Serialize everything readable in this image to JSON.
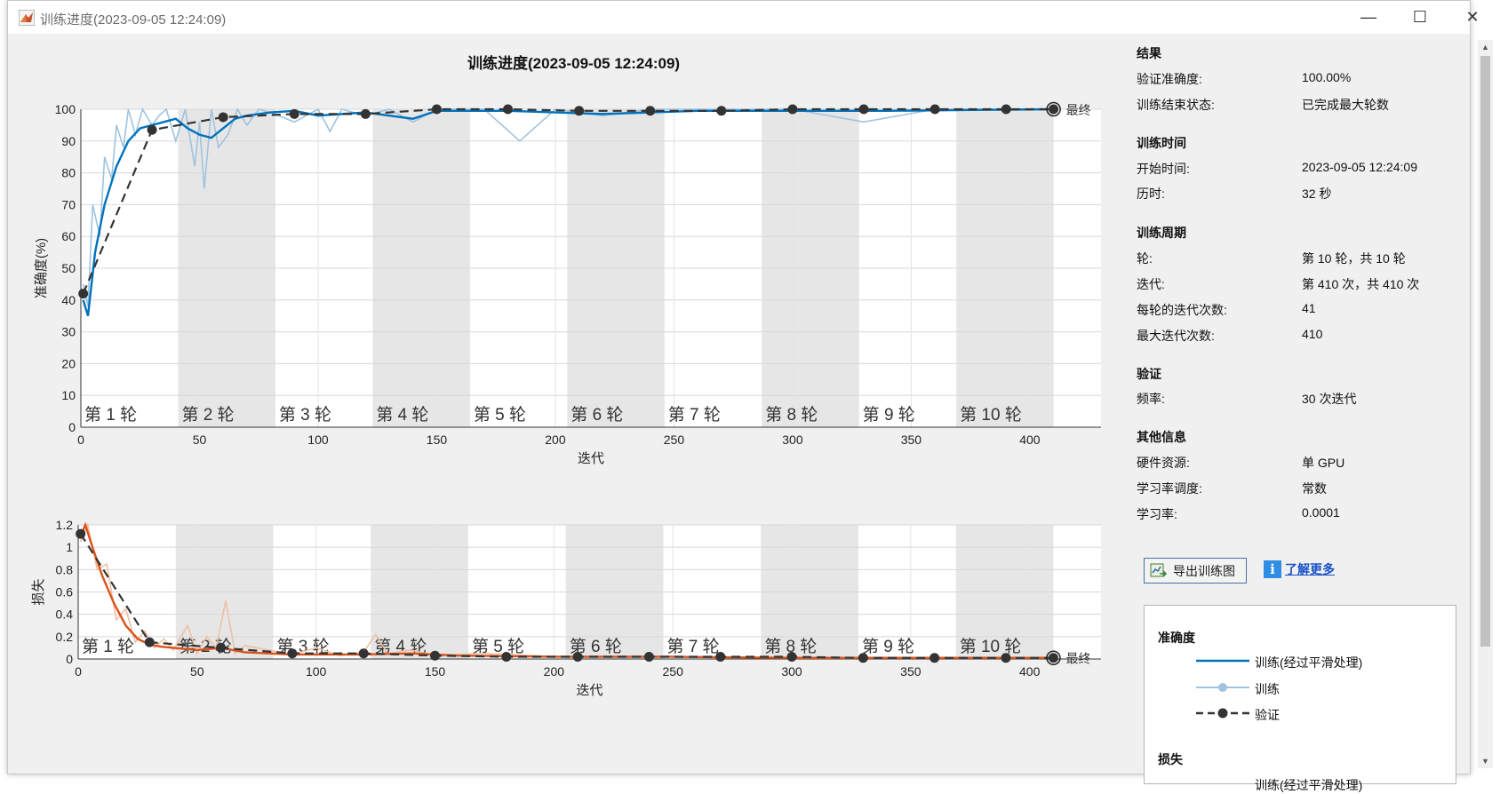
{
  "window": {
    "title": "训练进度(2023-09-05 12:24:09)",
    "minimize": "—",
    "maximize": "☐",
    "close": "✕"
  },
  "plot_title": "训练进度(2023-09-05 12:24:09)",
  "side": {
    "results": {
      "heading": "结果",
      "rows": [
        {
          "k": "验证准确度:",
          "v": "100.00%"
        },
        {
          "k": "训练结束状态:",
          "v": "已完成最大轮数"
        }
      ]
    },
    "time": {
      "heading": "训练时间",
      "rows": [
        {
          "k": "开始时间:",
          "v": "2023-09-05 12:24:09"
        },
        {
          "k": "历时:",
          "v": "32 秒"
        }
      ]
    },
    "cycle": {
      "heading": "训练周期",
      "rows": [
        {
          "k": "轮:",
          "v": "第 10 轮，共 10 轮"
        },
        {
          "k": "迭代:",
          "v": "第 410 次，共 410 次"
        },
        {
          "k": "每轮的迭代次数:",
          "v": "41"
        },
        {
          "k": "最大迭代次数:",
          "v": "410"
        }
      ]
    },
    "validation": {
      "heading": "验证",
      "rows": [
        {
          "k": "频率:",
          "v": "30 次迭代"
        }
      ]
    },
    "other": {
      "heading": "其他信息",
      "rows": [
        {
          "k": "硬件资源:",
          "v": "单 GPU"
        },
        {
          "k": "学习率调度:",
          "v": "常数"
        },
        {
          "k": "学习率:",
          "v": "0.0001"
        }
      ]
    }
  },
  "export_button": "导出训练图",
  "learn_more": "了解更多",
  "legend": {
    "accuracy_heading": "准确度",
    "items": [
      "训练(经过平滑处理)",
      "训练",
      "验证"
    ],
    "loss_heading": "损失",
    "loss_first_item": "训练(经过平滑处理)"
  },
  "colors": {
    "accuracy_smoothed": "#0072bd",
    "accuracy_raw": "#9fc3e0",
    "loss_smoothed": "#d95319",
    "loss_raw": "#efbfa6",
    "validation": "#333333",
    "epoch_band": "#e6e6e6"
  },
  "chart_data": [
    {
      "type": "line",
      "title": "",
      "xlabel": "迭代",
      "ylabel": "准确度(%)",
      "xlim": [
        0,
        430
      ],
      "ylim": [
        0,
        100
      ],
      "xticks": [
        0,
        50,
        100,
        150,
        200,
        250,
        300,
        350,
        400
      ],
      "yticks": [
        0,
        10,
        20,
        30,
        40,
        50,
        60,
        70,
        80,
        90,
        100
      ],
      "grid": true,
      "epoch_labels": [
        "第 1 轮",
        "第 2 轮",
        "第 3 轮",
        "第 4 轮",
        "第 5 轮",
        "第 6 轮",
        "第 7 轮",
        "第 8 轮",
        "第 9 轮",
        "第 10 轮"
      ],
      "iterations_per_epoch": 41,
      "final_label": "最终",
      "series": [
        {
          "name": "训练(经过平滑处理)",
          "x": [
            1,
            3,
            6,
            10,
            15,
            20,
            25,
            30,
            35,
            40,
            45,
            50,
            55,
            60,
            65,
            70,
            80,
            90,
            100,
            110,
            120,
            130,
            140,
            150,
            160,
            180,
            200,
            220,
            240,
            260,
            300,
            340,
            380,
            410
          ],
          "y": [
            40,
            35,
            55,
            70,
            82,
            90,
            94,
            95,
            96,
            97,
            94,
            92,
            91,
            94,
            97,
            98,
            99,
            99.5,
            98,
            98.5,
            99,
            98,
            97,
            99.5,
            99.5,
            99.5,
            99,
            98.5,
            99,
            99.5,
            99.5,
            99.5,
            99.8,
            100
          ]
        },
        {
          "name": "训练",
          "x": [
            1,
            3,
            5,
            8,
            10,
            13,
            15,
            18,
            20,
            23,
            26,
            30,
            33,
            36,
            40,
            44,
            48,
            50,
            52,
            55,
            58,
            62,
            66,
            70,
            75,
            80,
            90,
            100,
            105,
            110,
            120,
            130,
            140,
            150,
            170,
            185,
            200,
            220,
            240,
            260,
            300,
            330,
            360,
            400,
            410
          ],
          "y": [
            45,
            38,
            70,
            60,
            85,
            78,
            95,
            88,
            100,
            92,
            100,
            95,
            98,
            100,
            90,
            100,
            82,
            96,
            75,
            100,
            88,
            92,
            100,
            95,
            100,
            99,
            96,
            100,
            93,
            100,
            98,
            100,
            96,
            100,
            100,
            90,
            100,
            98,
            100,
            100,
            100,
            96,
            100,
            100,
            100
          ]
        },
        {
          "name": "验证",
          "x": [
            1,
            30,
            60,
            90,
            120,
            150,
            180,
            210,
            240,
            270,
            300,
            330,
            360,
            390,
            410
          ],
          "y": [
            42,
            93.5,
            97.5,
            98.5,
            98.5,
            100,
            100,
            99.5,
            99.5,
            99.5,
            100,
            100,
            100,
            100,
            100
          ]
        }
      ]
    },
    {
      "type": "line",
      "title": "",
      "xlabel": "迭代",
      "ylabel": "损失",
      "xlim": [
        0,
        430
      ],
      "ylim": [
        0,
        1.2
      ],
      "xticks": [
        0,
        50,
        100,
        150,
        200,
        250,
        300,
        350,
        400
      ],
      "yticks": [
        0,
        0.2,
        0.4,
        0.6,
        0.8,
        1,
        1.2
      ],
      "grid": true,
      "epoch_labels": [
        "第 1 轮",
        "第 2 轮",
        "第 3 轮",
        "第 4 轮",
        "第 5 轮",
        "第 6 轮",
        "第 7 轮",
        "第 8 轮",
        "第 9 轮",
        "第 10 轮"
      ],
      "iterations_per_epoch": 41,
      "final_label": "最终",
      "series": [
        {
          "name": "训练(经过平滑处理)",
          "x": [
            1,
            3,
            6,
            10,
            15,
            20,
            25,
            30,
            35,
            40,
            50,
            60,
            70,
            80,
            90,
            100,
            120,
            140,
            160,
            200,
            250,
            300,
            350,
            400,
            410
          ],
          "y": [
            1.1,
            1.2,
            1.0,
            0.75,
            0.5,
            0.3,
            0.18,
            0.13,
            0.11,
            0.1,
            0.08,
            0.1,
            0.06,
            0.05,
            0.04,
            0.04,
            0.04,
            0.05,
            0.03,
            0.02,
            0.02,
            0.01,
            0.01,
            0.01,
            0.01
          ]
        },
        {
          "name": "训练",
          "x": [
            1,
            4,
            8,
            12,
            16,
            20,
            24,
            28,
            32,
            36,
            40,
            46,
            50,
            54,
            58,
            62,
            66,
            70,
            80,
            90,
            100,
            110,
            120,
            125,
            130,
            140,
            150,
            170,
            200,
            250,
            300,
            350,
            400,
            410
          ],
          "y": [
            1.05,
            1.2,
            0.8,
            0.85,
            0.35,
            0.45,
            0.15,
            0.25,
            0.1,
            0.18,
            0.08,
            0.3,
            0.05,
            0.2,
            0.1,
            0.52,
            0.05,
            0.12,
            0.08,
            0.04,
            0.1,
            0.03,
            0.06,
            0.22,
            0.05,
            0.08,
            0.03,
            0.05,
            0.02,
            0.02,
            0.01,
            0.01,
            0.01,
            0.01
          ]
        },
        {
          "name": "验证",
          "x": [
            1,
            30,
            60,
            90,
            120,
            150,
            180,
            210,
            240,
            270,
            300,
            330,
            360,
            390,
            410
          ],
          "y": [
            1.12,
            0.15,
            0.1,
            0.05,
            0.05,
            0.03,
            0.02,
            0.02,
            0.02,
            0.02,
            0.02,
            0.01,
            0.01,
            0.01,
            0.01
          ]
        }
      ]
    }
  ]
}
